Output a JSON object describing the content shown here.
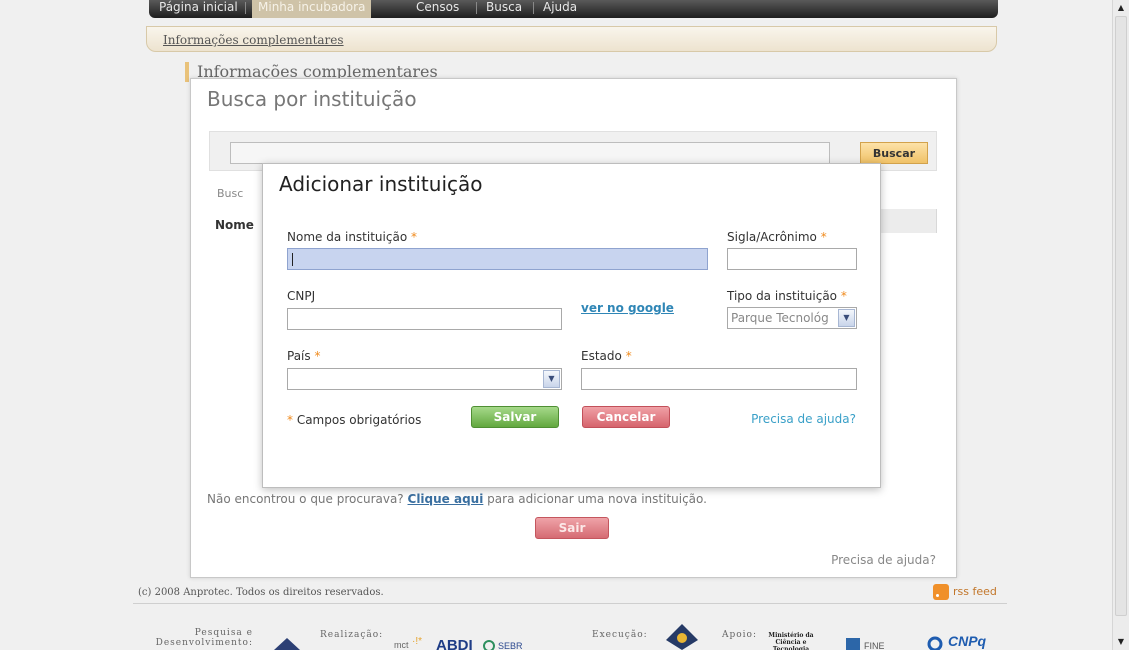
{
  "nav": {
    "tabs": [
      "Página inicial",
      "Minha incubadora",
      "Censos",
      "Busca",
      "Ajuda"
    ]
  },
  "breadcrumb": "Informações complementares",
  "section_heading": "Informações complementares",
  "search_dialog": {
    "title": "Busca por instituição",
    "search_value": "",
    "buscar_label": "Buscar",
    "busc_label": "Busc",
    "column_nome": "Nome",
    "not_found_text": "Não encontrou o que procurava?",
    "click_here": "Clique aqui",
    "add_new_text": "para adicionar uma nova instituição.",
    "sair_label": "Sair",
    "help_label": "Precisa de ajuda?"
  },
  "modal": {
    "title": "Adicionar instituição",
    "nome_label": "Nome da instituição",
    "sigla_label": "Sigla/Acrônimo",
    "cnpj_label": "CNPJ",
    "google_link": "ver no google",
    "tipo_label": "Tipo da instituição",
    "tipo_value": "Parque Tecnológ",
    "pais_label": "País",
    "pais_value": "",
    "estado_label": "Estado",
    "required_marker": "*",
    "required_note": "Campos obrigatórios",
    "salvar_label": "Salvar",
    "cancelar_label": "Cancelar",
    "help_label": "Precisa de ajuda?"
  },
  "footer": {
    "copyright": "(c) 2008 Anprotec. Todos os direitos reservados.",
    "rss_label": "rss feed",
    "sponsors": {
      "pesquisa": "Pesquisa e Desenvolvimento:",
      "realizacao": "Realização:",
      "execucao": "Execução:",
      "apoio": "Apoio:",
      "ministerio": "Ministério da Ciência e Tecnologia",
      "cnpq": "CNPq"
    }
  },
  "colors": {
    "accent_orange": "#f08a1c",
    "salvar_green": "#62a83f",
    "cancelar_red": "#d6646d",
    "link_blue": "#2f86b6"
  }
}
